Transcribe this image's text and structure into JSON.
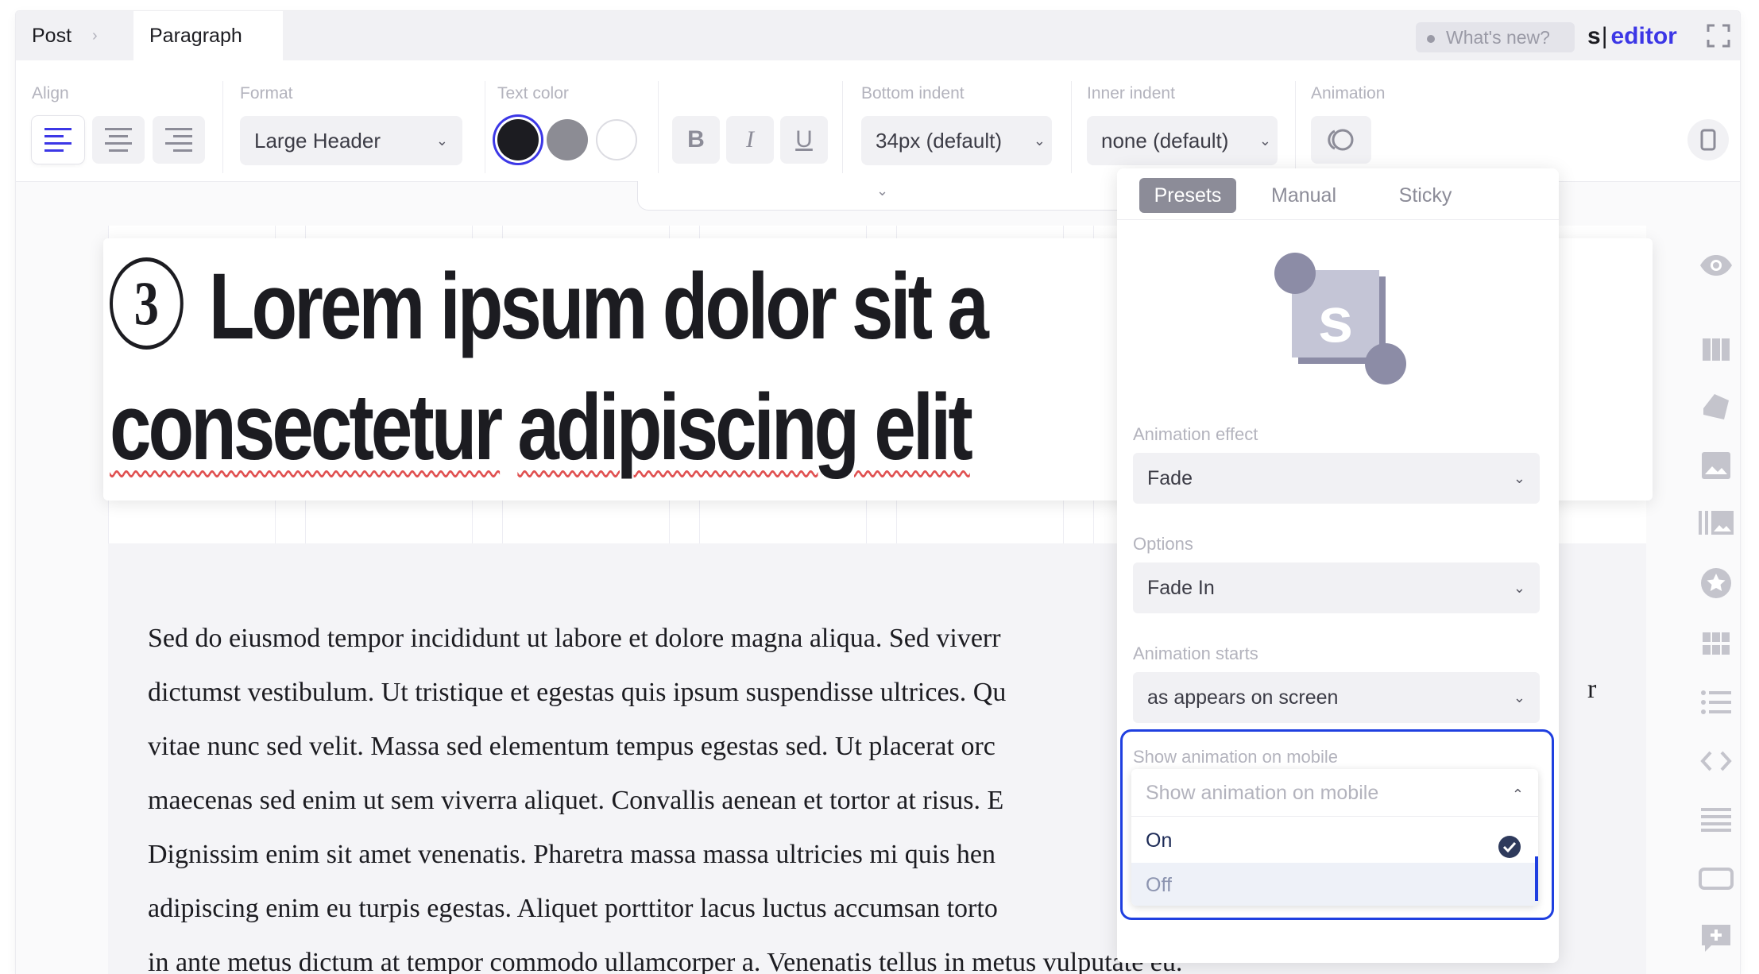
{
  "breadcrumb": {
    "items": [
      "Post",
      "Paragraph"
    ]
  },
  "header": {
    "whats_new": "What's new?",
    "brand_s": "s",
    "brand_editor": "editor"
  },
  "toolbar": {
    "align_label": "Align",
    "format_label": "Format",
    "format_value": "Large Header",
    "text_color_label": "Text color",
    "colors": [
      "#1c1c21",
      "#8c8c94",
      "#ffffff"
    ],
    "bold": "B",
    "italic": "I",
    "underline": "U",
    "bottom_indent_label": "Bottom indent",
    "bottom_indent_value": "34px (default)",
    "inner_indent_label": "Inner indent",
    "inner_indent_value": "none (default)",
    "animation_label": "Animation"
  },
  "content": {
    "heading_number": "3",
    "heading_line1": "Lorem ipsum dolor sit a",
    "heading_line2_word1": "consectetur",
    "heading_line2_rest": "adipiscing elit",
    "paragraph_lines": [
      "Sed do eiusmod tempor incididunt ut labore et dolore magna aliqua. Sed viverr",
      "dictumst vestibulum. Ut tristique et egestas quis ipsum suspendisse ultrices. Qu",
      "vitae nunc sed velit. Massa sed elementum tempus egestas sed. Ut placerat orc",
      "maecenas sed enim ut sem viverra aliquet. Convallis aenean et tortor at risus. E",
      "Dignissim enim sit amet venenatis. Pharetra massa massa ultricies mi quis hen",
      "adipiscing enim eu turpis egestas. Aliquet porttitor lacus luctus accumsan torto",
      "in ante metus dictum at tempor commodo ullamcorper a. Venenatis tellus in metus vulputate eu."
    ],
    "paragraph_stray_char": "r"
  },
  "panel": {
    "tabs": [
      "Presets",
      "Manual",
      "Sticky"
    ],
    "effect_label": "Animation effect",
    "effect_value": "Fade",
    "options_label": "Options",
    "options_value": "Fade In",
    "starts_label": "Animation starts",
    "starts_value": "as appears on screen",
    "mobile_label": "Show animation on mobile",
    "mobile_placeholder": "Show animation on mobile",
    "mobile_options": [
      "On",
      "Off"
    ],
    "mobile_selected": "On"
  },
  "colors": {
    "accent": "#3c37e6",
    "focus": "#1f3fe0",
    "spell_error": "#e05151"
  }
}
